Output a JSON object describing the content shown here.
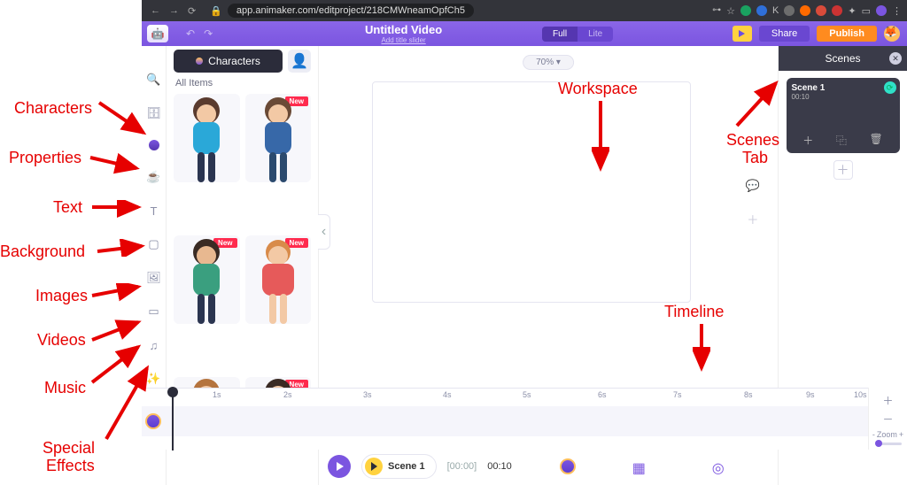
{
  "browser": {
    "url": "app.animaker.com/editproject/218CMWneamOpfCh5"
  },
  "topbar": {
    "title": "Untitled Video",
    "subtitle": "Add title slider",
    "full": "Full",
    "lite": "Lite",
    "share": "Share",
    "publish": "Publish"
  },
  "library": {
    "tab": "Characters",
    "heading": "All Items",
    "new_badge": "New"
  },
  "workspace": {
    "zoom": "70%",
    "collapse": "‹"
  },
  "tl_controls": {
    "scene_label": "Scene 1",
    "pos": "[00:00]",
    "dur": "00:10"
  },
  "scenes": {
    "title": "Scenes",
    "card": {
      "name": "Scene 1",
      "time": "00:10",
      "add": "＋",
      "dup": "⿻",
      "del": "🗑"
    }
  },
  "timeline": {
    "marks": [
      "1s",
      "2s",
      "3s",
      "4s",
      "5s",
      "6s",
      "7s",
      "8s",
      "9s",
      "10s"
    ],
    "zoom_label": "Zoom",
    "plus": "＋",
    "minus": "－"
  },
  "annotations": {
    "characters": "Characters",
    "properties": "Properties",
    "text": "Text",
    "background": "Background",
    "images": "Images",
    "videos": "Videos",
    "music": "Music",
    "sfx1": "Special",
    "sfx2": "Effects",
    "workspace": "Workspace",
    "timeline": "Timeline",
    "scenes1": "Scenes",
    "scenes2": "Tab"
  }
}
